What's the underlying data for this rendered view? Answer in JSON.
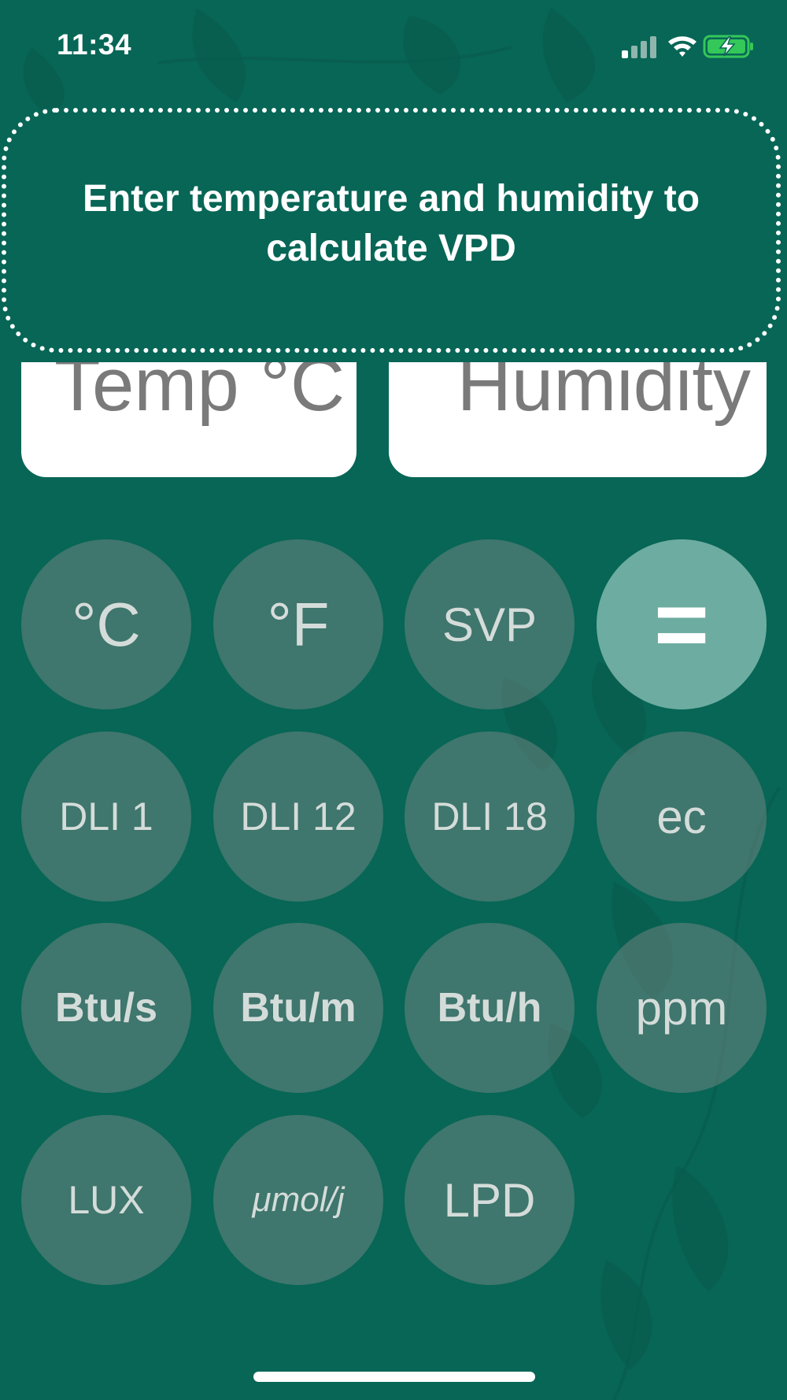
{
  "status_bar": {
    "time": "11:34"
  },
  "prompt": {
    "text": "Enter temperature and humidity to calculate VPD"
  },
  "inputs": {
    "temperature_placeholder": "Temp °C",
    "humidity_placeholder": "Humidity"
  },
  "keypad": {
    "celsius": "°C",
    "fahrenheit": "°F",
    "svp": "SVP",
    "equals": "=",
    "dli_1": "DLI 1",
    "dli_12": "DLI 12",
    "dli_18": "DLI 18",
    "ec": "ec",
    "btu_s": "Btu/s",
    "btu_m": "Btu/m",
    "btu_h": "Btu/h",
    "ppm": "ppm",
    "lux": "LUX",
    "umol_j": "μmol/j",
    "lpd": "LPD"
  },
  "colors": {
    "background": "#076656",
    "key_fill": "#5f7d76",
    "equals_fill": "#6aada2",
    "battery_green": "#34c759"
  },
  "icons": [
    "signal-icon",
    "wifi-icon",
    "battery-charging-icon"
  ]
}
